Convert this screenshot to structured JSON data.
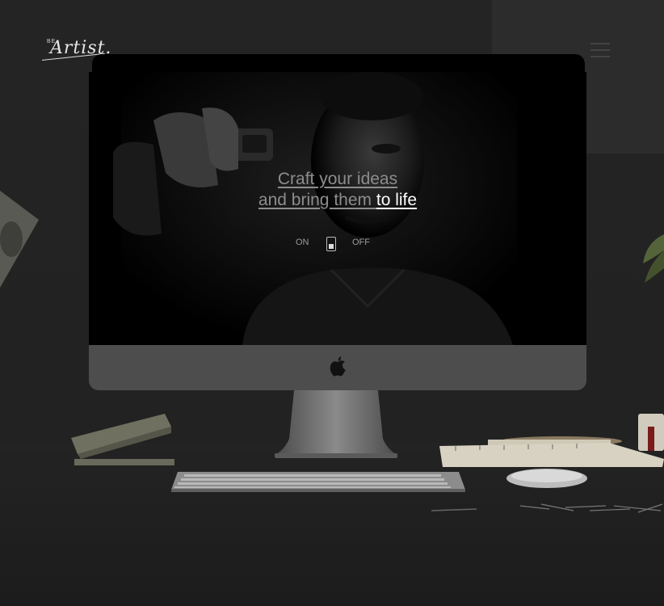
{
  "logo": {
    "prefix": "BE",
    "name": "Artist."
  },
  "hero": {
    "line1": "Craft your ideas",
    "line2_part1": "and bring them ",
    "line2_highlight": "to life"
  },
  "toggle": {
    "on_label": "ON",
    "off_label": "OFF",
    "state": "off"
  },
  "icons": {
    "menu": "hamburger-menu-icon",
    "brand": "apple-logo-icon"
  },
  "colors": {
    "background": "#222222",
    "highlight": "#ffffff",
    "muted_text": "#8d8d8d"
  }
}
